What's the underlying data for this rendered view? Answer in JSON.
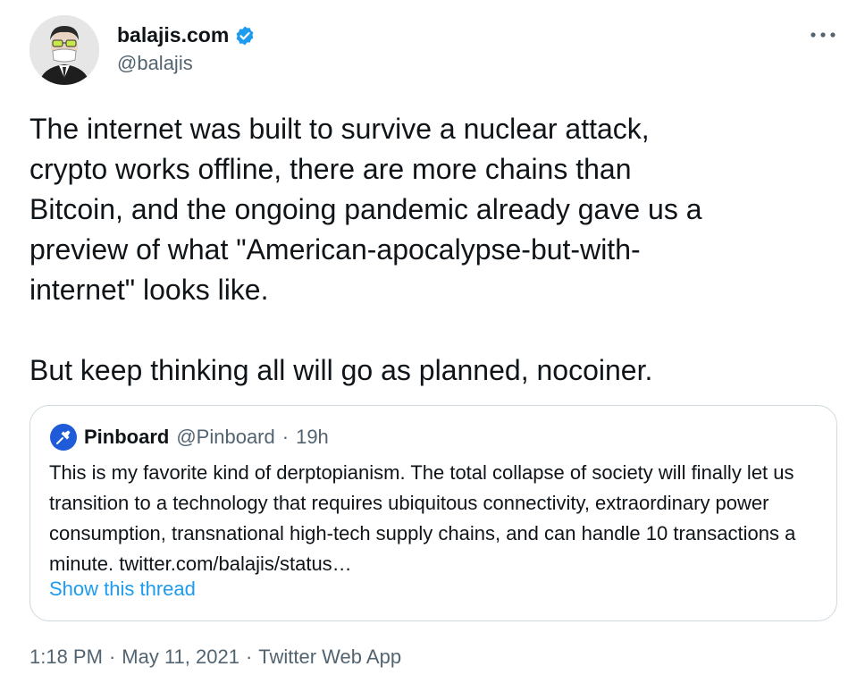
{
  "author": {
    "name": "balajis.com",
    "handle": "@balajis",
    "verified": true
  },
  "tweet": {
    "text": "The internet was built to survive a nuclear attack,\ncrypto works offline, there are more chains than\nBitcoin, and the ongoing pandemic already gave us a\npreview of what \"American-apocalypse-but-with-\ninternet\" looks like.\n\nBut keep thinking all will go as planned, nocoiner."
  },
  "quoted_tweet": {
    "name": "Pinboard",
    "handle": "@Pinboard",
    "separator": "·",
    "time": "19h",
    "text": "This is my favorite kind of derptopianism. The total collapse of society will finally let us transition to a technology that requires ubiquitous connectivity, extraordinary power consumption, transnational high-tech supply chains, and can handle 10 transactions a minute. twitter.com/balajis/status…",
    "show_thread_label": "Show this thread"
  },
  "meta": {
    "time": "1:18 PM",
    "separator": "·",
    "date": "May 11, 2021",
    "source": "Twitter Web App"
  },
  "icons": {
    "more": "more-horizontal-icon",
    "verified": "verified-badge-icon"
  },
  "colors": {
    "text": "#0f1419",
    "secondary": "#536471",
    "accent": "#1d9bf0",
    "border": "#cfd9de",
    "pinboard_blue": "#1f5ad8"
  }
}
